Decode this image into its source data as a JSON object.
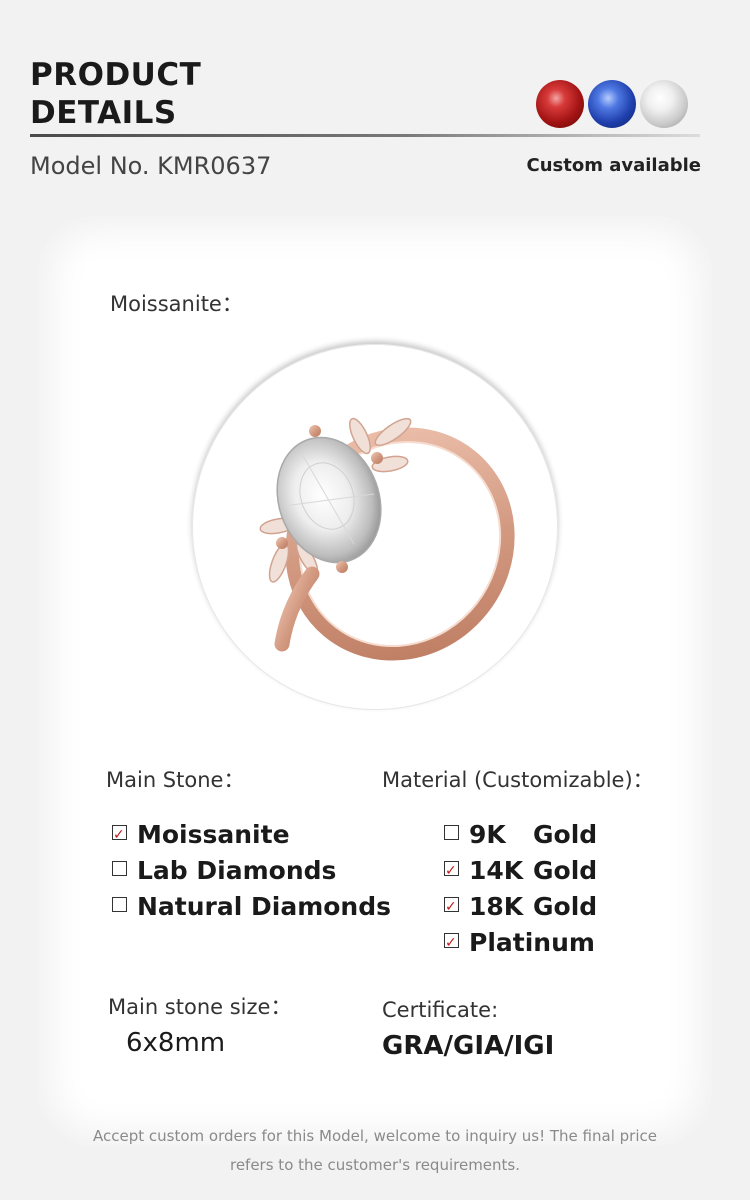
{
  "header": {
    "title_line1": "PRODUCT",
    "title_line2": "DETAILS",
    "model": "Model No. KMR0637",
    "custom": "Custom available",
    "gems": [
      "red-gem-icon",
      "blue-gem-icon",
      "white-gem-icon"
    ]
  },
  "card": {
    "moissanite_label": "Moissanite：",
    "main_stone": {
      "label": "Main Stone：",
      "options": [
        {
          "text": "Moissanite",
          "checked": true
        },
        {
          "text": "Lab Diamonds",
          "checked": false
        },
        {
          "text": "Natural Diamonds",
          "checked": false
        }
      ]
    },
    "material": {
      "label": "Material (Customizable)：",
      "options": [
        {
          "karat": "9K",
          "metal": "Gold",
          "checked": false
        },
        {
          "karat": "14K",
          "metal": "Gold",
          "checked": true
        },
        {
          "karat": "18K",
          "metal": "Gold",
          "checked": true
        },
        {
          "karat": "Platinum",
          "metal": "",
          "checked": true
        }
      ]
    },
    "size": {
      "label": "Main stone size：",
      "value": "6x8mm"
    },
    "certificate": {
      "label": "Certificate:",
      "value": "GRA/GIA/IGI"
    }
  },
  "note": {
    "line1": "Accept custom orders for this Model, welcome to inquiry us! The final price",
    "line2": "refers to the customer's requirements."
  },
  "colors": {
    "rose_gold": "#d9a48f",
    "check": "#c01818"
  }
}
